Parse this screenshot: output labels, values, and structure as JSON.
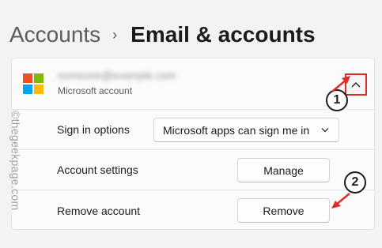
{
  "breadcrumb": {
    "parent": "Accounts",
    "separator": "›",
    "current": "Email & accounts"
  },
  "account": {
    "email": "someone@example.com",
    "type": "Microsoft account",
    "logo_colors": [
      "#f25022",
      "#7fba00",
      "#00a4ef",
      "#ffb900"
    ],
    "collapse_icon": "chevron-up-icon"
  },
  "rows": [
    {
      "label": "Sign in options",
      "control": "Microsoft apps can sign me in"
    },
    {
      "label": "Account settings",
      "control": "Manage"
    },
    {
      "label": "Remove account",
      "control": "Remove"
    }
  ],
  "watermark": "©thegeekpage.com",
  "annotations": {
    "step1": "1",
    "step2": "2",
    "highlight_color": "#e02b2b"
  }
}
